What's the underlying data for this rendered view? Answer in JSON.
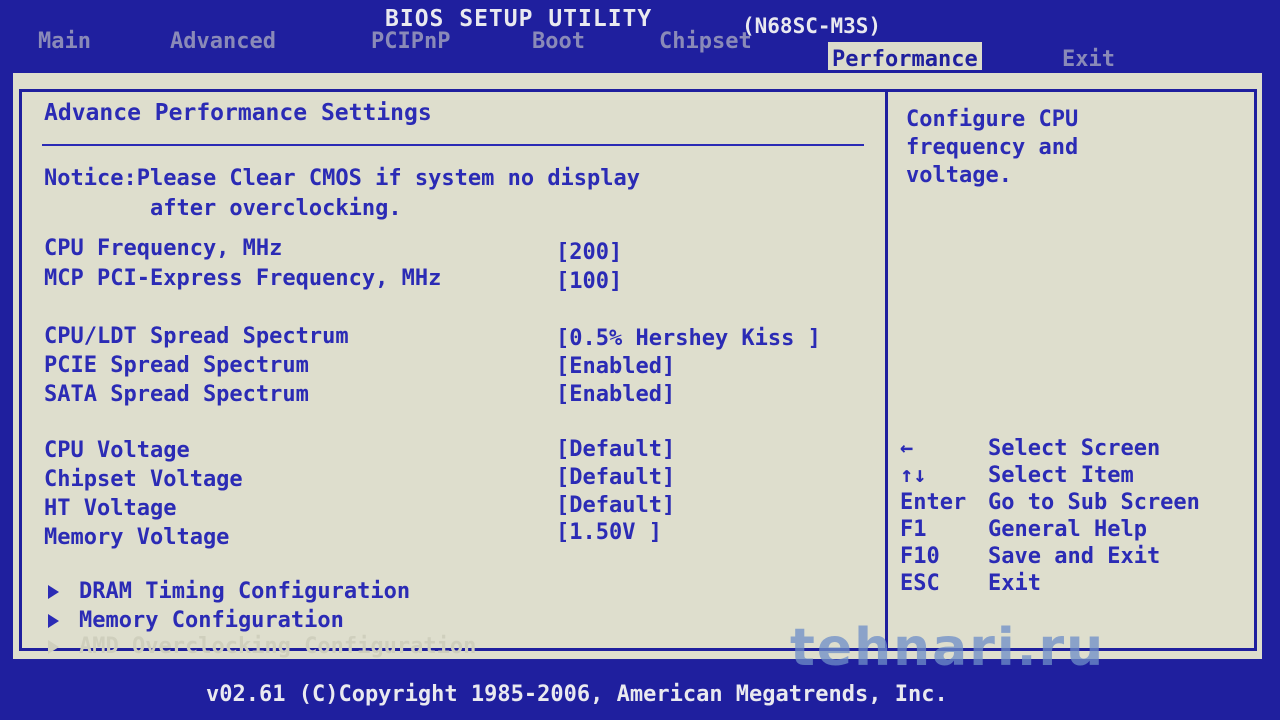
{
  "window": {
    "title": "BIOS SETUP UTILITY",
    "model": "(N68SC-M3S)"
  },
  "tabs": [
    {
      "label": "Main"
    },
    {
      "label": "Advanced"
    },
    {
      "label": "PCIPnP"
    },
    {
      "label": "Boot"
    },
    {
      "label": "Chipset"
    },
    {
      "label": "Performance",
      "active": true
    },
    {
      "label": "Exit"
    }
  ],
  "section_title": "Advance Performance Settings",
  "notice": "Notice:Please Clear CMOS if system no display\n        after overclocking.",
  "settings": [
    {
      "label": "CPU Frequency, MHz",
      "value": "[200]"
    },
    {
      "label": "MCP PCI-Express Frequency, MHz",
      "value": "[100]"
    },
    {
      "label": "CPU/LDT Spread Spectrum",
      "value": "[0.5% Hershey Kiss ]"
    },
    {
      "label": "PCIE Spread Spectrum",
      "value": "[Enabled]"
    },
    {
      "label": "SATA Spread Spectrum",
      "value": "[Enabled]"
    },
    {
      "label": "CPU Voltage",
      "value": "[Default]"
    },
    {
      "label": "Chipset Voltage",
      "value": "[Default]"
    },
    {
      "label": "HT Voltage",
      "value": "[Default]"
    },
    {
      "label": "Memory Voltage",
      "value": "[1.50V ]"
    }
  ],
  "submenus": [
    {
      "label": "DRAM Timing Configuration",
      "enabled": true
    },
    {
      "label": "Memory Configuration",
      "enabled": true
    },
    {
      "label": "AMD Overclocking Configuration",
      "enabled": false
    }
  ],
  "help": {
    "description": "Configure CPU\nfrequency and\nvoltage."
  },
  "keys": [
    {
      "key": "←",
      "action": "Select Screen"
    },
    {
      "key": "↑↓",
      "action": "Select Item"
    },
    {
      "key": "Enter",
      "action": "Go to Sub Screen"
    },
    {
      "key": "F1",
      "action": "General Help"
    },
    {
      "key": "F10",
      "action": "Save and Exit"
    },
    {
      "key": "ESC",
      "action": "Exit"
    }
  ],
  "footer": "v02.61 (C)Copyright 1985-2006, American Megatrends, Inc.",
  "watermark": "tehnari.ru",
  "colors": {
    "background_blue": "#1f1f9e",
    "panel": "#dedecd",
    "text_blue": "#2b2bb5"
  }
}
